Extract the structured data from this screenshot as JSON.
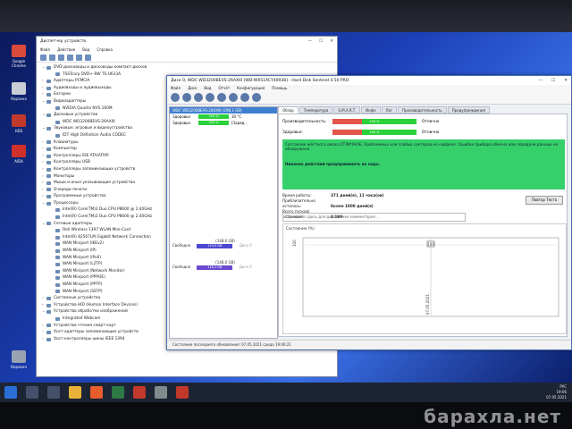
{
  "device_manager": {
    "title": "Диспетчер устройств",
    "menu": [
      "Файл",
      "Действие",
      "Вид",
      "Справка"
    ],
    "tree": [
      {
        "label": "DVD-дисководы и дисководы компакт-дисков",
        "level": 0,
        "expanded": true
      },
      {
        "label": "TSSTcorp DVD+-RW TS-U633A",
        "level": 1
      },
      {
        "label": "Адаптеры PCMCIA",
        "level": 0
      },
      {
        "label": "Аудиовходы и аудиовыходы",
        "level": 0
      },
      {
        "label": "Батареи",
        "level": 0
      },
      {
        "label": "Видеоадаптеры",
        "level": 0,
        "expanded": true
      },
      {
        "label": "NVIDIA Quadro NVS 160M",
        "level": 1
      },
      {
        "label": "Дисковые устройства",
        "level": 0,
        "expanded": true
      },
      {
        "label": "WDC WD3200BEVS-26AXI0",
        "level": 1
      },
      {
        "label": "Звуковые, игровые и видеоустройства",
        "level": 0,
        "expanded": true
      },
      {
        "label": "IDT High Definition Audio CODEC",
        "level": 1
      },
      {
        "label": "Клавиатуры",
        "level": 0
      },
      {
        "label": "Компьютер",
        "level": 0
      },
      {
        "label": "Контроллеры IDE ATA/ATAPI",
        "level": 0
      },
      {
        "label": "Контроллеры USB",
        "level": 0
      },
      {
        "label": "Контроллеры запоминающих устройств",
        "level": 0
      },
      {
        "label": "Мониторы",
        "level": 0
      },
      {
        "label": "Мыши и иные указывающие устройства",
        "level": 0
      },
      {
        "label": "Очереди печати",
        "level": 0
      },
      {
        "label": "Программные устройства",
        "level": 0
      },
      {
        "label": "Процессоры",
        "level": 0,
        "expanded": true
      },
      {
        "label": "Intel(R) Core(TM)2 Duo CPU     P8600  @ 2.40GHz",
        "level": 1
      },
      {
        "label": "Intel(R) Core(TM)2 Duo CPU     P8600  @ 2.40GHz",
        "level": 1
      },
      {
        "label": "Сетевые адаптеры",
        "level": 0,
        "expanded": true
      },
      {
        "label": "Dell Wireless 1397 WLAN Mini-Card",
        "level": 1
      },
      {
        "label": "Intel(R) 82567LM Gigabit Network Connection",
        "level": 1
      },
      {
        "label": "WAN Miniport (IKEv2)",
        "level": 1
      },
      {
        "label": "WAN Miniport (IP)",
        "level": 1
      },
      {
        "label": "WAN Miniport (IPv6)",
        "level": 1
      },
      {
        "label": "WAN Miniport (L2TP)",
        "level": 1
      },
      {
        "label": "WAN Miniport (Network Monitor)",
        "level": 1
      },
      {
        "label": "WAN Miniport (PPPOE)",
        "level": 1
      },
      {
        "label": "WAN Miniport (PPTP)",
        "level": 1
      },
      {
        "label": "WAN Miniport (SSTP)",
        "level": 1
      },
      {
        "label": "Системные устройства",
        "level": 0
      },
      {
        "label": "Устройства HID (Human Interface Devices)",
        "level": 0
      },
      {
        "label": "Устройства обработки изображений",
        "level": 0,
        "expanded": true
      },
      {
        "label": "Integrated Webcam",
        "level": 1
      },
      {
        "label": "Устройства чтения смарт-карт",
        "level": 0
      },
      {
        "label": "Хост-адаптеры запоминающих устройств",
        "level": 0
      },
      {
        "label": "Хост-контроллеры шины IEEE 1394",
        "level": 0
      }
    ]
  },
  "hds": {
    "title": "Диск 0, WDC WD3200BEVS-26AXI0 [WD-WX51ACY40938] - Hard Disk Sentinel 4.50 PRO",
    "menu": [
      "Файл",
      "Диск",
      "Вид",
      "Отчёт",
      "Конфигурация",
      "Помощь"
    ],
    "disk_header": "WDC WD3200BEVS-26AXI0 (298,1 GB)",
    "health_label": "Здоровье",
    "health_value": "100 %",
    "perf_label": "Здоровье",
    "perf_value": "100 %",
    "temp_label": "30 °C",
    "temp_extra": "[Заряд...",
    "volumes": [
      {
        "size": "(148,0 GB)",
        "label": "Свободно",
        "value": "123,9 GB",
        "drive": "Диск 0"
      },
      {
        "size": "(148,0 GB)",
        "label": "Свободно",
        "value": "118,1 GB",
        "drive": "Диск 0"
      }
    ],
    "tabs": [
      "Обзор",
      "Температура",
      "S.M.A.R.T.",
      "Инфо",
      "Лог",
      "Производительность",
      "Предупреждения"
    ],
    "rows": [
      {
        "label": "Производительность:",
        "bar": "100 %",
        "status": "Отлично"
      },
      {
        "label": "Здоровье:",
        "bar": "100 %",
        "status": "Отлично"
      }
    ],
    "message": "Состояние жёсткого диска ОТЛИЧНОЕ. Проблемных или слабых секторов не найдено. Ошибок прибора обмена или передачи данных не обнаружено.",
    "message_bold": "Никаких действий предпринимать не надо.",
    "info": [
      {
        "k": "Время работы:",
        "v": "371 дней(я), 11 часа(ов)"
      },
      {
        "k": "Приблизительно осталось:",
        "v": "более 1000 дней(я)"
      },
      {
        "k": "Всего пусков/остановок:",
        "v": "4 199"
      }
    ],
    "check_button": "Повтор Теста",
    "comment_placeholder": "Щелкните здесь для добавления комментария ...",
    "chart_title": "Состояние (%)",
    "chart_point_label": "100",
    "chart_ylabel": "100",
    "chart_xlabel": "07.05.2021",
    "statusbar": "Состояние последнего обновления: 07.05.2021 среда 19:06:21"
  },
  "desktop_icons": [
    {
      "label": "Google Chrome",
      "color": "#d94a3c"
    },
    {
      "label": "Корзина",
      "color": "#c8cdd6"
    },
    {
      "label": "HDS",
      "color": "#c0392b"
    },
    {
      "label": "AIDA",
      "color": "#d0302a"
    },
    {
      "label": "Корзина",
      "color": "#9aa3b2"
    }
  ],
  "taskbar": {
    "lang": "РУС",
    "time": "19:06",
    "date": "07.05.2021"
  },
  "watermark": "барахла.нет"
}
